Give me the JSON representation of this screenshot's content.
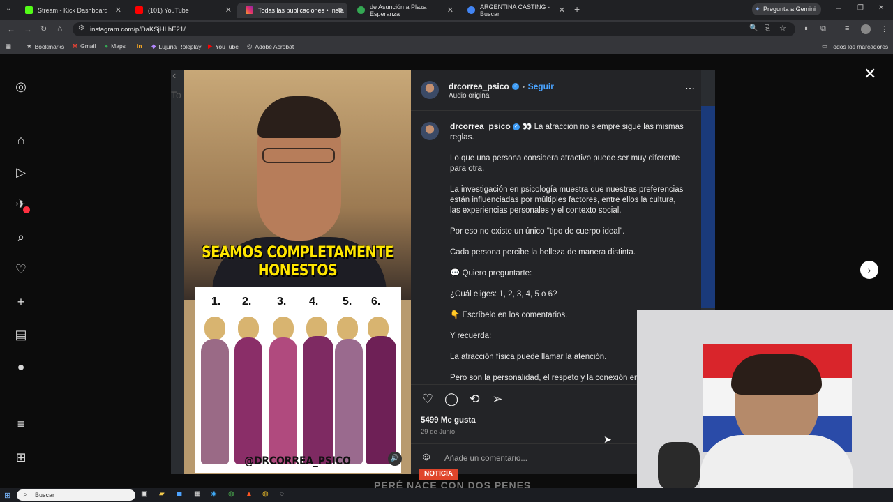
{
  "browser": {
    "tabs": [
      {
        "title": "Stream - Kick Dashboard",
        "favicon_color": "#53fc18",
        "active": false
      },
      {
        "title": "(101) YouTube",
        "favicon_color": "#ff0000",
        "active": false
      },
      {
        "title": "Todas las publicaciones • Insta",
        "favicon_color": "#e1306c",
        "active": true
      },
      {
        "title": "de Asunción a Plaza Esperanza",
        "favicon_color": "#34a853",
        "active": false
      },
      {
        "title": "ARGENTINA CASTING - Buscar",
        "favicon_color": "#4285f4",
        "active": false
      }
    ],
    "gemini_button": "Pregunta a Gemini",
    "url": "instagram.com/p/DaKSjHLhE21/",
    "bookmarks": [
      {
        "label": "Bookmarks",
        "icon": "star-icon"
      },
      {
        "label": "Gmail",
        "icon": "gmail-icon"
      },
      {
        "label": "Maps",
        "icon": "maps-icon"
      },
      {
        "label": "",
        "icon": "in-icon"
      },
      {
        "label": "Lujuria Roleplay",
        "icon": "roleplay-icon"
      },
      {
        "label": "YouTube",
        "icon": "youtube-icon"
      },
      {
        "label": "Adobe Acrobat",
        "icon": "acrobat-icon"
      }
    ],
    "all_bookmarks": "Todos los marcadores"
  },
  "post": {
    "username": "drcorrea_psico",
    "follow": "Seguir",
    "audio": "Audio original",
    "headline": "SEAMOS COMPLETAMENTE HONESTOS",
    "image_numbers": [
      "1.",
      "2.",
      "3.",
      "4.",
      "5.",
      "6."
    ],
    "image_handle": "@DRCORREA_PSICO",
    "caption_first": "👀 La atracción no siempre sigue las mismas reglas.",
    "caption_paragraphs": [
      "Lo que una persona considera atractivo puede ser muy diferente para otra.",
      "La investigación en psicología muestra que nuestras preferencias están influenciadas por múltiples factores, entre ellos la cultura, las experiencias personales y el contexto social.",
      "Por eso no existe un único \"tipo de cuerpo ideal\".",
      "Cada persona percibe la belleza de manera distinta.",
      "💬 Quiero preguntarte:",
      "¿Cuál eliges: 1, 2, 3, 4, 5 o 6?",
      "👇 Escríbelo en los comentarios.",
      "Y recuerda:",
      "La atracción física puede llamar la atención.",
      "Pero son la personalidad, el respeto y la conexión em"
    ],
    "likes": "5499 Me gusta",
    "date": "29 de Junio",
    "comment_placeholder": "Añade un comentario..."
  },
  "taskbar": {
    "search_label": "Buscar"
  },
  "overlay_text": "PERÉ NACE CON DOS PENES",
  "overlay_badge": "NOTICIA"
}
